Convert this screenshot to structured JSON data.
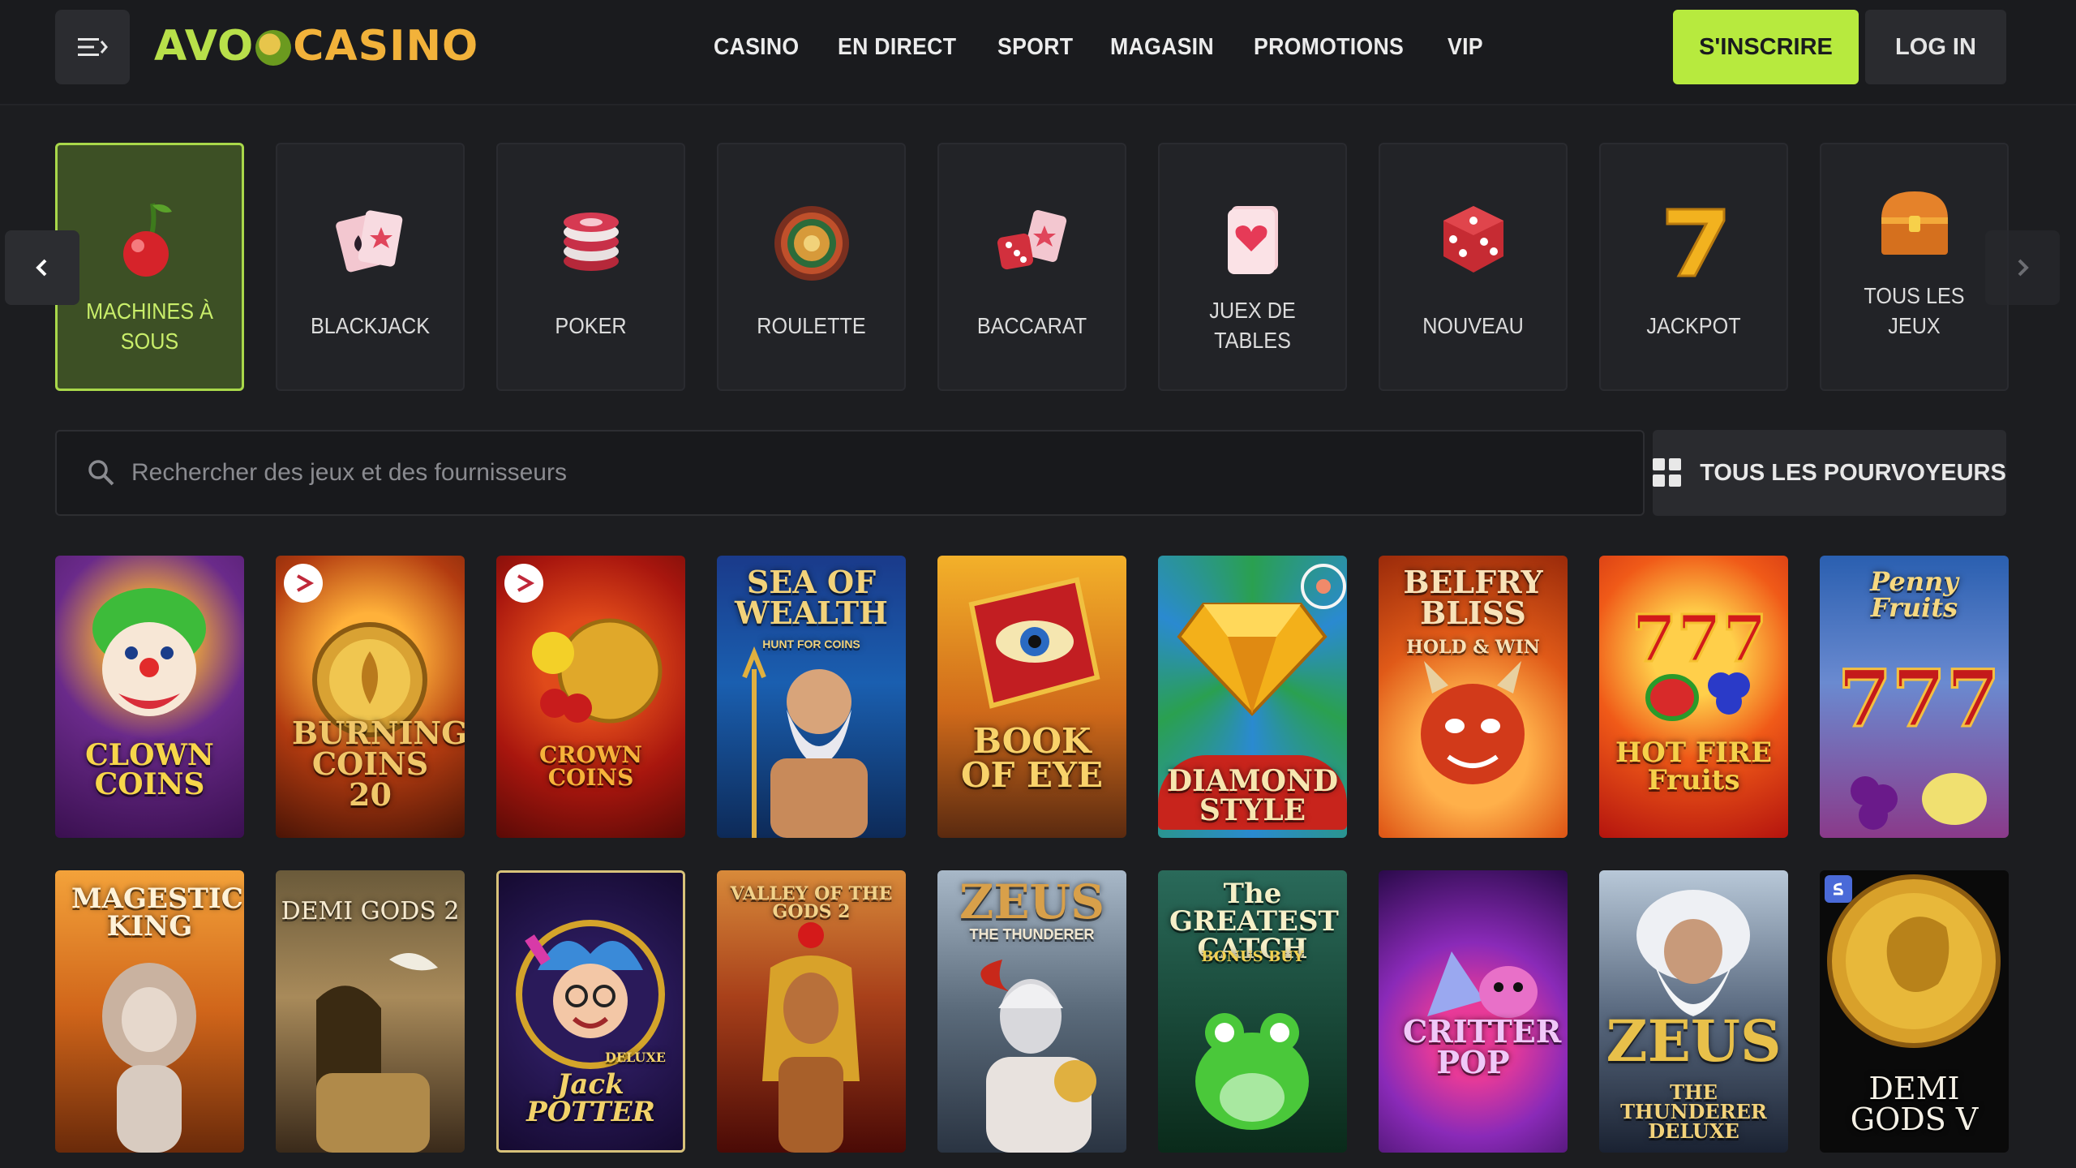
{
  "header": {
    "logo_avo": "AVO",
    "logo_casino": "CASINO",
    "nav": [
      "CASINO",
      "EN DIRECT",
      "SPORT",
      "MAGASIN",
      "PROMOTIONS",
      "VIP"
    ],
    "signup_label": "S'INSCRIRE",
    "login_label": "LOG IN"
  },
  "categories": [
    {
      "label": "MACHINES À SOUS",
      "icon": "cherry-icon",
      "active": true
    },
    {
      "label": "BLACKJACK",
      "icon": "cards-icon"
    },
    {
      "label": "POKER",
      "icon": "chips-icon"
    },
    {
      "label": "ROULETTE",
      "icon": "roulette-icon"
    },
    {
      "label": "BACCARAT",
      "icon": "dice-card-icon"
    },
    {
      "label": "JUEX DE TABLES",
      "icon": "heart-card-icon"
    },
    {
      "label": "NOUVEAU",
      "icon": "dice-icon"
    },
    {
      "label": "JACKPOT",
      "icon": "seven-icon"
    },
    {
      "label": "TOUS LES JEUX",
      "icon": "treasure-chest-icon"
    }
  ],
  "search": {
    "placeholder": "Rechercher des jeux et des fournisseurs",
    "providers_label": "TOUS LES POURVOYEURS"
  },
  "games": [
    {
      "title": "CLOWN COINS"
    },
    {
      "title": "BURNING COINS 20"
    },
    {
      "title": "CROWN COINS"
    },
    {
      "title": "SEA OF WEALTH",
      "subtitle": "HUNT FOR COINS"
    },
    {
      "title": "BOOK OF EYE"
    },
    {
      "title": "DIAMOND STYLE"
    },
    {
      "title": "BELFRY BLISS",
      "subtitle": "HOLD & WIN"
    },
    {
      "title": "HOT FIRE Fruits"
    },
    {
      "title": "Penny Fruits"
    },
    {
      "title": "MAGESTIC KING"
    },
    {
      "title": "DEMI GODS 2"
    },
    {
      "title": "Jack POTTER",
      "subtitle": "DELUXE"
    },
    {
      "title": "VALLEY OF THE GODS 2"
    },
    {
      "title": "ZEUS",
      "subtitle": "THE THUNDERER"
    },
    {
      "title": "The GREATEST CATCH",
      "subtitle": "BONUS BUY"
    },
    {
      "title": "CRITTER POP"
    },
    {
      "title": "ZEUS",
      "subtitle": "THE THUNDERER DELUXE"
    },
    {
      "title": "DEMI GODS V"
    }
  ],
  "colors": {
    "accent": "#b7ea3e",
    "background": "#1c1d20",
    "active_category_bg": "#3d5025"
  }
}
